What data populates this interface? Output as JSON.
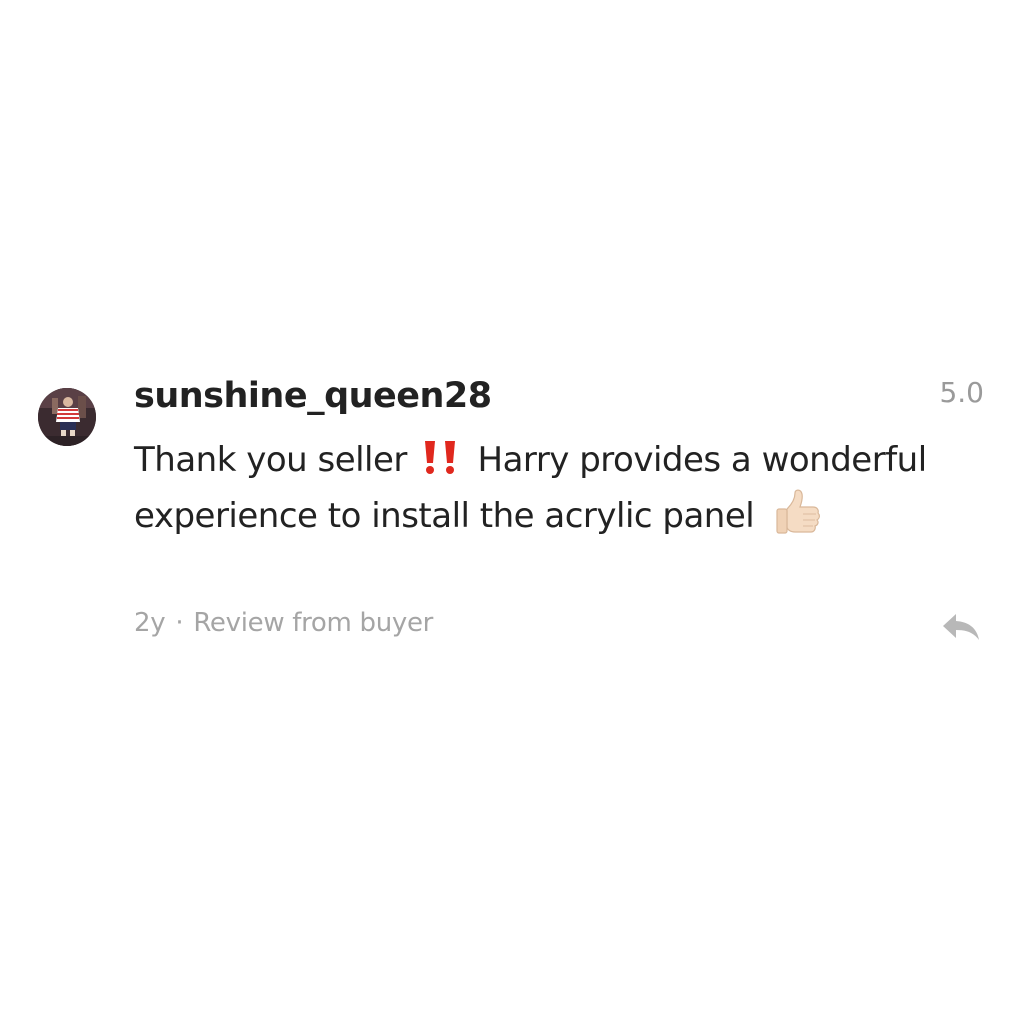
{
  "review": {
    "username": "sunshine_queen28",
    "rating": "5.0",
    "text_part1": "Thank you seller",
    "text_part2": "Harry provides a wonderful experience to install the acrylic panel",
    "age": "2y",
    "separator": "·",
    "source": "Review from buyer",
    "emojis": [
      "double-exclamation-icon",
      "thumbs-up-icon"
    ]
  },
  "colors": {
    "text": "#222222",
    "muted": "#a5a5a5",
    "accent_red": "#e0281e"
  }
}
